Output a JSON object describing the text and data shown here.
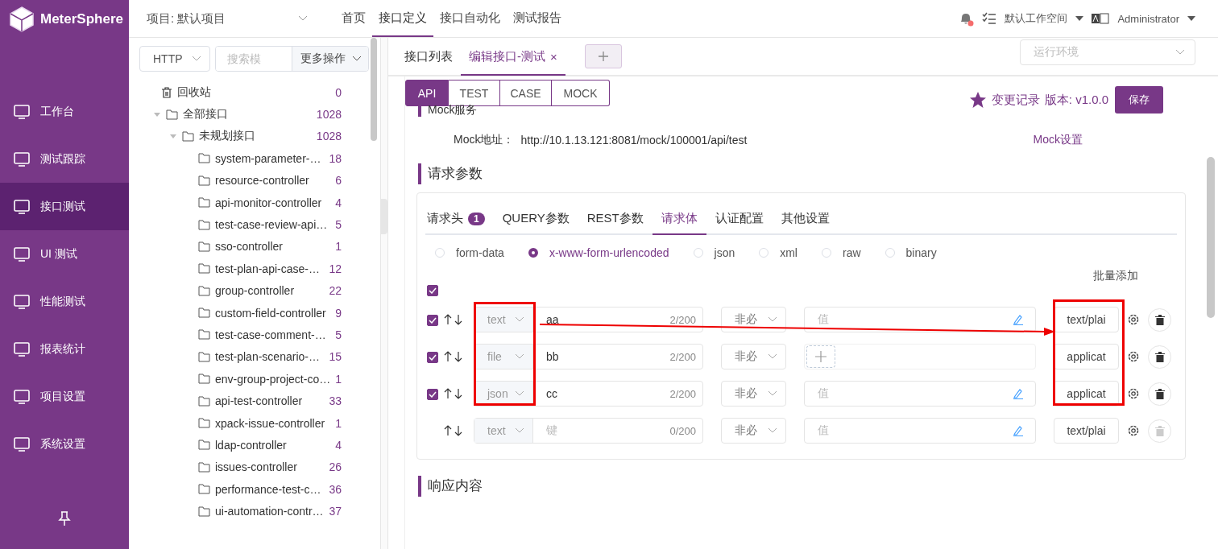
{
  "logo": {
    "text": "MeterSphere"
  },
  "sidebar": {
    "items": [
      {
        "label": "工作台",
        "selected": false
      },
      {
        "label": "测试跟踪",
        "selected": false
      },
      {
        "label": "接口测试",
        "selected": true
      },
      {
        "label": "UI 测试",
        "selected": false
      },
      {
        "label": "性能测试",
        "selected": false
      },
      {
        "label": "报表统计",
        "selected": false
      },
      {
        "label": "项目设置",
        "selected": false
      },
      {
        "label": "系统设置",
        "selected": false
      }
    ]
  },
  "header": {
    "project": "项目: 默认项目",
    "nav": [
      {
        "label": "首页",
        "selected": false
      },
      {
        "label": "接口定义",
        "selected": true
      },
      {
        "label": "接口自动化",
        "selected": false
      },
      {
        "label": "测试报告",
        "selected": false
      }
    ],
    "workspace": "默认工作空间",
    "user": "Administrator"
  },
  "tree_toolbar": {
    "protocol": "HTTP",
    "search_placeholder": "搜索模",
    "more": "更多操作"
  },
  "tree": {
    "trash": {
      "label": "回收站",
      "count": "0"
    },
    "nodes": [
      {
        "label": "全部接口",
        "count": "1028",
        "expanded": true,
        "children": [
          {
            "label": "未规划接口",
            "count": "1028",
            "expanded": true,
            "children": [
              {
                "label": "system-parameter-…",
                "count": "18"
              },
              {
                "label": "resource-controller",
                "count": "6"
              },
              {
                "label": "api-monitor-controller",
                "count": "4"
              },
              {
                "label": "test-case-review-api…",
                "count": "5"
              },
              {
                "label": "sso-controller",
                "count": "1"
              },
              {
                "label": "test-plan-api-case-…",
                "count": "12"
              },
              {
                "label": "group-controller",
                "count": "22"
              },
              {
                "label": "custom-field-controller",
                "count": "9"
              },
              {
                "label": "test-case-comment-…",
                "count": "5"
              },
              {
                "label": "test-plan-scenario-…",
                "count": "15"
              },
              {
                "label": "env-group-project-co…",
                "count": "1"
              },
              {
                "label": "api-test-controller",
                "count": "33"
              },
              {
                "label": "xpack-issue-controller",
                "count": "1"
              },
              {
                "label": "ldap-controller",
                "count": "4"
              },
              {
                "label": "issues-controller",
                "count": "26"
              },
              {
                "label": "performance-test-c…",
                "count": "36"
              },
              {
                "label": "ui-automation-contr…",
                "count": "37"
              }
            ]
          }
        ]
      }
    ]
  },
  "tabs": [
    {
      "label": "接口列表",
      "selected": false
    },
    {
      "label": "编辑接口-测试",
      "selected": true,
      "close": "×"
    }
  ],
  "environment": {
    "placeholder": "运行环境"
  },
  "mode_buttons": [
    {
      "label": "API",
      "selected": true
    },
    {
      "label": "TEST",
      "selected": false
    },
    {
      "label": "CASE",
      "selected": false
    },
    {
      "label": "MOCK",
      "selected": false
    }
  ],
  "version": {
    "history": "变更记录",
    "version": "版本: v1.0.0",
    "save": "保存"
  },
  "mock": {
    "title": "Mock服务",
    "address_label": "Mock地址：",
    "address": "http://10.1.13.121:8081/mock/100001/api/test",
    "settings": "Mock设置"
  },
  "request": {
    "title": "请求参数",
    "tabs": [
      {
        "label": "请求头",
        "badge": "1",
        "selected": false
      },
      {
        "label": "QUERY参数",
        "selected": false
      },
      {
        "label": "REST参数",
        "selected": false
      },
      {
        "label": "请求体",
        "selected": true
      },
      {
        "label": "认证配置",
        "selected": false
      },
      {
        "label": "其他设置",
        "selected": false
      }
    ],
    "body_types": [
      {
        "label": "form-data",
        "selected": false
      },
      {
        "label": "x-www-form-urlencoded",
        "selected": true
      },
      {
        "label": "json",
        "selected": false
      },
      {
        "label": "xml",
        "selected": false
      },
      {
        "label": "raw",
        "selected": false
      },
      {
        "label": "binary",
        "selected": false
      }
    ],
    "batch_add": "批量添加",
    "select_all": {
      "checked": true
    },
    "rows": [
      {
        "kind": "text",
        "checked": true,
        "type": "text",
        "key": "aa",
        "key_count": "2/200",
        "required": "非必",
        "value_placeholder": "值",
        "content_type": "text/plai"
      },
      {
        "kind": "file",
        "checked": true,
        "type": "file",
        "key": "bb",
        "key_count": "2/200",
        "required": "非必",
        "content_type": "applicat"
      },
      {
        "kind": "text",
        "checked": true,
        "type": "json",
        "key": "cc",
        "key_count": "2/200",
        "required": "非必",
        "value_placeholder": "值",
        "content_type": "applicat"
      },
      {
        "kind": "new",
        "type": "text",
        "key_placeholder": "键",
        "key_count": "0/200",
        "required": "非必",
        "value_placeholder": "值",
        "content_type": "text/plai"
      }
    ]
  },
  "response": {
    "title": "响应内容"
  }
}
